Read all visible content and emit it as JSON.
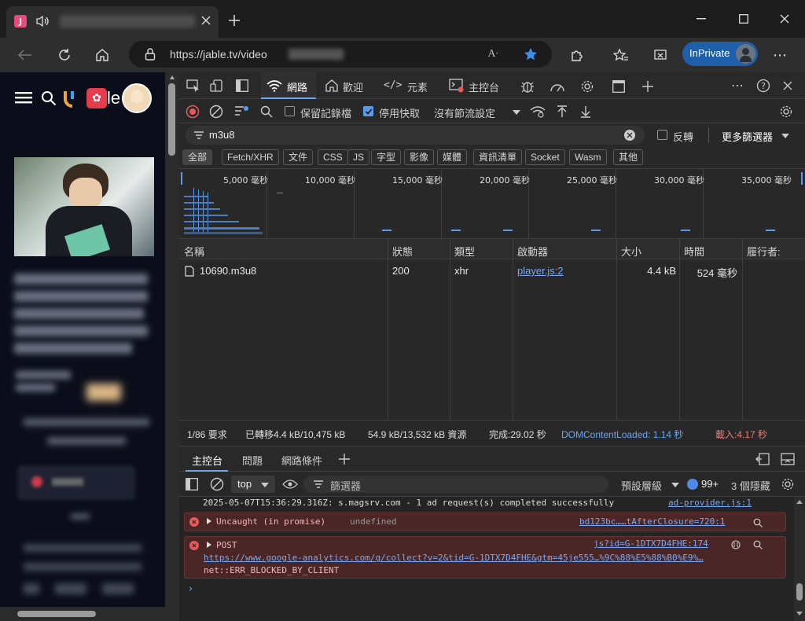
{
  "browser": {
    "tab_favicon": "J",
    "url": "https://jable.tv/video",
    "inprivate": "InPrivate"
  },
  "site": {
    "logo_text": "le"
  },
  "devtools": {
    "tabs": {
      "network": "網路",
      "welcome": "歡迎",
      "elements": "元素",
      "console": "主控台"
    },
    "toolbar": {
      "preserve_log": "保留記錄檔",
      "disable_cache": "停用快取",
      "throttle": "沒有節流設定"
    },
    "filter": {
      "value": "m3u8",
      "invert": "反轉",
      "more": "更多篩選器"
    },
    "filter_buttons": [
      "全部",
      "Fetch/XHR",
      "文件",
      "CSS",
      "JS",
      "字型",
      "影像",
      "媒體",
      "資訊清單",
      "Socket",
      "Wasm",
      "其他"
    ],
    "timeline_ticks": [
      "5,000 毫秒",
      "10,000 毫秒",
      "15,000 毫秒",
      "20,000 毫秒",
      "25,000 毫秒",
      "30,000 毫秒",
      "35,000 毫秒"
    ],
    "columns": [
      "名稱",
      "狀態",
      "類型",
      "啟動器",
      "大小",
      "時間",
      "履行者:"
    ],
    "rows": [
      {
        "name": "10690.m3u8",
        "status": "200",
        "type": "xhr",
        "initiator": "player.js:2",
        "size": "4.4 kB",
        "time": "524 毫秒"
      }
    ],
    "summary": {
      "requests": "1/86 要求",
      "transferred": "已轉移4.4 kB/10,475 kB",
      "resources": "54.9 kB/13,532 kB 資源",
      "finish": "完成:29.02 秒",
      "dcl": "DOMContentLoaded: 1.14 秒",
      "load": "載入:4.17 秒"
    },
    "drawer_tabs": {
      "console": "主控台",
      "issues": "問題",
      "conditions": "網路條件"
    },
    "console_bar": {
      "context": "top",
      "filter_placeholder": "篩選器",
      "levels": "預設層級",
      "issues_count": "99+",
      "hidden": "3 個隱藏"
    },
    "console": {
      "line1_text": "2025-05-07T15:36:29.316Z: s.magsrv.com - 1 ad request(s) completed successfully",
      "line1_src": "ad-provider.js:1",
      "line2_text": "Uncaught (in promise)",
      "line2_undef": "undefined",
      "line2_src": "bd123bc……tAfterClosure=720:1",
      "line3_text": "POST",
      "line3_src": "js?id=G-1DTX7D4FHE:174",
      "line3_url": "https://www.google-analytics.com/g/collect?v=2&tid=G-1DTX7D4FHE&gtm=45je555…%9C%88%E5%88%B0%E9%…",
      "line3_err": "net::ERR_BLOCKED_BY_CLIENT"
    }
  }
}
